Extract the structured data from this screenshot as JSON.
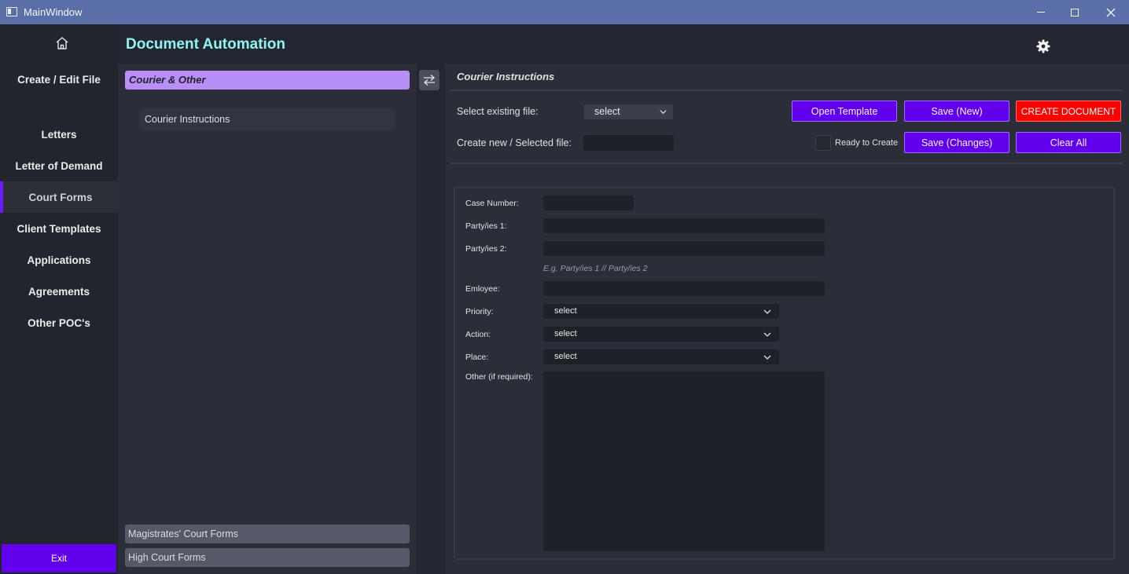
{
  "window": {
    "title": "MainWindow"
  },
  "header": {
    "app_title": "Document Automation"
  },
  "nav": {
    "items": [
      {
        "label": "Create / Edit File"
      },
      {
        "label": "Letters"
      },
      {
        "label": "Letter of Demand"
      },
      {
        "label": "Court Forms"
      },
      {
        "label": "Client Templates"
      },
      {
        "label": "Applications"
      },
      {
        "label": "Agreements"
      },
      {
        "label": "Other POC's"
      }
    ],
    "active": "Court Forms",
    "exit_label": "Exit"
  },
  "categories": {
    "open": {
      "label": "Courier & Other",
      "items": [
        "Courier Instructions"
      ]
    },
    "bottom": [
      "Magistrates' Court Forms",
      "High Court Forms"
    ]
  },
  "main": {
    "section_title": "Courier Instructions",
    "select_existing_label": "Select existing file:",
    "select_existing_value": "select",
    "create_new_label": "Create new / Selected file:",
    "create_new_value": "",
    "ready_label": "Ready to Create",
    "ready_checked": false,
    "buttons": {
      "open_template": "Open Template",
      "save_new": "Save (New)",
      "create_document": "CREATE DOCUMENT",
      "save_changes": "Save (Changes)",
      "clear_all": "Clear All"
    }
  },
  "form": {
    "case_number_label": "Case Number:",
    "party1_label": "Party/ies 1:",
    "party2_label": "Party/ies 2:",
    "party_hint": "E.g. Party/ies 1 // Party/ies 2",
    "employee_label": "Emloyee:",
    "priority_label": "Priority:",
    "priority_value": "select",
    "action_label": "Action:",
    "action_value": "select",
    "place_label": "Place:",
    "place_value": "select",
    "other_label": "Other (if required):"
  },
  "colors": {
    "accent_purple": "#6200ee",
    "danger_red": "#ff0000",
    "category_header": "#b890f5",
    "title_cyan": "#8ff4f0",
    "titlebar": "#5a6fa8"
  },
  "icons": [
    "home-icon",
    "gear-icon",
    "swap-icon",
    "chevron-down-icon",
    "app-window-icon"
  ]
}
